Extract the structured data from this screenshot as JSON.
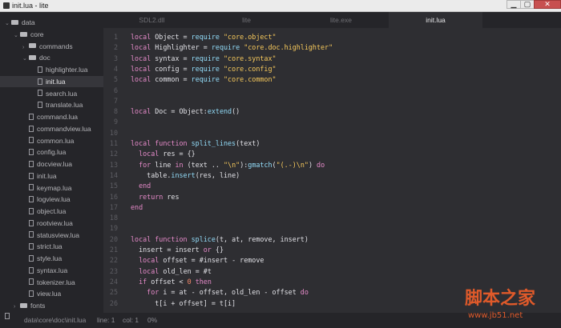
{
  "window": {
    "title": "init.lua - lite",
    "minimize": "▁",
    "maximize": "▢",
    "close": "✕"
  },
  "sidebar": {
    "items": [
      {
        "label": "data",
        "type": "folder",
        "depth": 0,
        "expanded": true
      },
      {
        "label": "core",
        "type": "folder",
        "depth": 1,
        "expanded": true
      },
      {
        "label": "commands",
        "type": "folder",
        "depth": 2,
        "expanded": false
      },
      {
        "label": "doc",
        "type": "folder",
        "depth": 2,
        "expanded": true
      },
      {
        "label": "highlighter.lua",
        "type": "file",
        "depth": 3
      },
      {
        "label": "init.lua",
        "type": "file",
        "depth": 3,
        "selected": true
      },
      {
        "label": "search.lua",
        "type": "file",
        "depth": 3
      },
      {
        "label": "translate.lua",
        "type": "file",
        "depth": 3
      },
      {
        "label": "command.lua",
        "type": "file",
        "depth": 2
      },
      {
        "label": "commandview.lua",
        "type": "file",
        "depth": 2
      },
      {
        "label": "common.lua",
        "type": "file",
        "depth": 2
      },
      {
        "label": "config.lua",
        "type": "file",
        "depth": 2
      },
      {
        "label": "docview.lua",
        "type": "file",
        "depth": 2
      },
      {
        "label": "init.lua",
        "type": "file",
        "depth": 2
      },
      {
        "label": "keymap.lua",
        "type": "file",
        "depth": 2
      },
      {
        "label": "logview.lua",
        "type": "file",
        "depth": 2
      },
      {
        "label": "object.lua",
        "type": "file",
        "depth": 2
      },
      {
        "label": "rootview.lua",
        "type": "file",
        "depth": 2
      },
      {
        "label": "statusview.lua",
        "type": "file",
        "depth": 2
      },
      {
        "label": "strict.lua",
        "type": "file",
        "depth": 2
      },
      {
        "label": "style.lua",
        "type": "file",
        "depth": 2
      },
      {
        "label": "syntax.lua",
        "type": "file",
        "depth": 2
      },
      {
        "label": "tokenizer.lua",
        "type": "file",
        "depth": 2
      },
      {
        "label": "view.lua",
        "type": "file",
        "depth": 2
      },
      {
        "label": "fonts",
        "type": "folder",
        "depth": 1,
        "expanded": false
      }
    ]
  },
  "tabs": [
    {
      "label": "SDL2.dll",
      "active": false
    },
    {
      "label": "lite",
      "active": false
    },
    {
      "label": "lite.exe",
      "active": false
    },
    {
      "label": "init.lua",
      "active": true
    }
  ],
  "editor": {
    "lines": [
      [
        [
          "kw",
          "local "
        ],
        [
          "id",
          "Object = "
        ],
        [
          "fn",
          "require "
        ],
        [
          "str",
          "\"core.object\""
        ]
      ],
      [
        [
          "kw",
          "local "
        ],
        [
          "id",
          "Highlighter = "
        ],
        [
          "fn",
          "require "
        ],
        [
          "str",
          "\"core.doc.highlighter\""
        ]
      ],
      [
        [
          "kw",
          "local "
        ],
        [
          "id",
          "syntax = "
        ],
        [
          "fn",
          "require "
        ],
        [
          "str",
          "\"core.syntax\""
        ]
      ],
      [
        [
          "kw",
          "local "
        ],
        [
          "id",
          "config = "
        ],
        [
          "fn",
          "require "
        ],
        [
          "str",
          "\"core.config\""
        ]
      ],
      [
        [
          "kw",
          "local "
        ],
        [
          "id",
          "common = "
        ],
        [
          "fn",
          "require "
        ],
        [
          "str",
          "\"core.common\""
        ]
      ],
      [],
      [],
      [
        [
          "kw",
          "local "
        ],
        [
          "id",
          "Doc = Object:"
        ],
        [
          "fn",
          "extend"
        ],
        [
          "id",
          "()"
        ]
      ],
      [],
      [],
      [
        [
          "kw",
          "local function "
        ],
        [
          "fn",
          "split_lines"
        ],
        [
          "id",
          "(text)"
        ]
      ],
      [
        [
          "id",
          "  "
        ],
        [
          "kw",
          "local "
        ],
        [
          "id",
          "res = {}"
        ]
      ],
      [
        [
          "id",
          "  "
        ],
        [
          "kw",
          "for "
        ],
        [
          "id",
          "line "
        ],
        [
          "kw",
          "in "
        ],
        [
          "id",
          "(text .. "
        ],
        [
          "str",
          "\"\\n\""
        ],
        [
          "id",
          "):"
        ],
        [
          "fn",
          "gmatch"
        ],
        [
          "id",
          "("
        ],
        [
          "str",
          "\"(.-)\\n\""
        ],
        [
          "id",
          ") "
        ],
        [
          "kw",
          "do"
        ]
      ],
      [
        [
          "id",
          "    table."
        ],
        [
          "fn",
          "insert"
        ],
        [
          "id",
          "(res, line)"
        ]
      ],
      [
        [
          "id",
          "  "
        ],
        [
          "kw",
          "end"
        ]
      ],
      [
        [
          "id",
          "  "
        ],
        [
          "kw",
          "return "
        ],
        [
          "id",
          "res"
        ]
      ],
      [
        [
          "kw",
          "end"
        ]
      ],
      [],
      [],
      [
        [
          "kw",
          "local function "
        ],
        [
          "fn",
          "splice"
        ],
        [
          "id",
          "(t, at, remove, insert)"
        ]
      ],
      [
        [
          "id",
          "  insert = insert "
        ],
        [
          "kw",
          "or "
        ],
        [
          "id",
          "{}"
        ]
      ],
      [
        [
          "id",
          "  "
        ],
        [
          "kw",
          "local "
        ],
        [
          "id",
          "offset = #insert - remove"
        ]
      ],
      [
        [
          "id",
          "  "
        ],
        [
          "kw",
          "local "
        ],
        [
          "id",
          "old_len = #t"
        ]
      ],
      [
        [
          "id",
          "  "
        ],
        [
          "kw",
          "if "
        ],
        [
          "id",
          "offset < "
        ],
        [
          "num",
          "0"
        ],
        [
          "kw",
          " then"
        ]
      ],
      [
        [
          "id",
          "    "
        ],
        [
          "kw",
          "for "
        ],
        [
          "id",
          "i = at - offset, old_len - offset "
        ],
        [
          "kw",
          "do"
        ]
      ],
      [
        [
          "id",
          "      t[i + offset] = t[i]"
        ]
      ]
    ]
  },
  "status": {
    "path": "data\\core\\doc\\init.lua",
    "line": "line: 1",
    "col": "col: 1",
    "percent": "0%"
  },
  "watermark": {
    "text": "脚本之家",
    "url": "www.jb51.net"
  }
}
